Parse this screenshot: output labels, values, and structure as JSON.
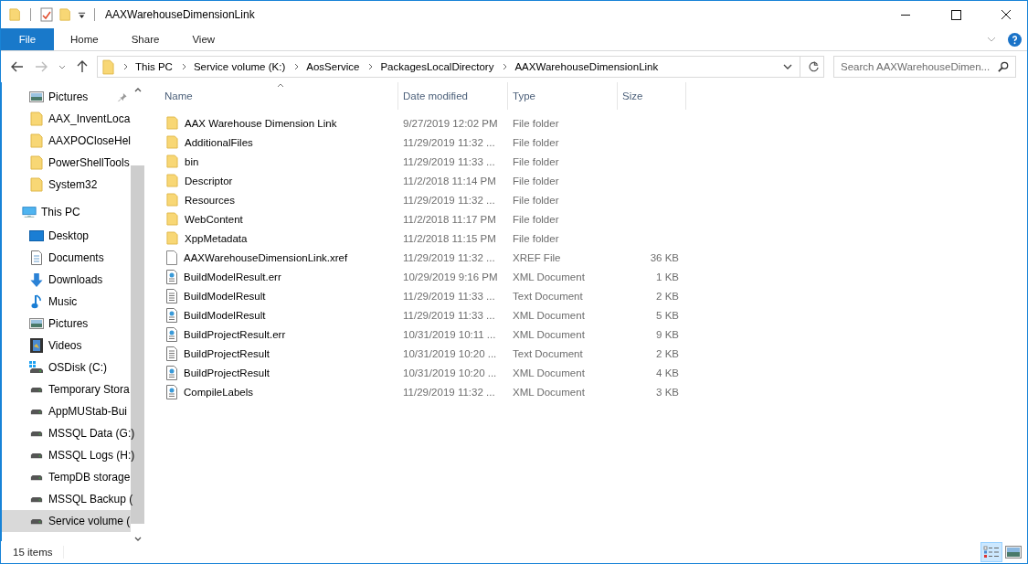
{
  "window": {
    "title": "AAXWarehouseDimensionLink"
  },
  "ribbon_tabs": [
    {
      "label": "File",
      "selected": true
    },
    {
      "label": "Home",
      "selected": false
    },
    {
      "label": "Share",
      "selected": false
    },
    {
      "label": "View",
      "selected": false
    }
  ],
  "address_bar": {
    "crumbs": [
      "This PC",
      "Service volume (K:)",
      "AosService",
      "PackagesLocalDirectory",
      "AAXWarehouseDimensionLink"
    ]
  },
  "search": {
    "placeholder": "Search AAXWarehouseDimen..."
  },
  "sidebar": {
    "quick_access_items": [
      {
        "label": "Pictures",
        "kind": "pictures",
        "pinned": true,
        "selected": false
      },
      {
        "label": "AAX_InventLoca",
        "kind": "folder",
        "pinned": false,
        "selected": false
      },
      {
        "label": "AAXPOCloseHel",
        "kind": "folder",
        "pinned": false,
        "selected": false
      },
      {
        "label": "PowerShellTools",
        "kind": "folder",
        "pinned": false,
        "selected": false
      },
      {
        "label": "System32",
        "kind": "folder",
        "pinned": false,
        "selected": false
      }
    ],
    "this_pc": {
      "label": "This PC",
      "children": [
        {
          "label": "Desktop",
          "kind": "desktop",
          "selected": false
        },
        {
          "label": "Documents",
          "kind": "documents",
          "selected": false
        },
        {
          "label": "Downloads",
          "kind": "downloads",
          "selected": false
        },
        {
          "label": "Music",
          "kind": "music",
          "selected": false
        },
        {
          "label": "Pictures",
          "kind": "pictures",
          "selected": false
        },
        {
          "label": "Videos",
          "kind": "videos",
          "selected": false
        },
        {
          "label": "OSDisk (C:)",
          "kind": "osdisk",
          "selected": false
        },
        {
          "label": "Temporary Stora",
          "kind": "drive",
          "selected": false
        },
        {
          "label": "AppMUStab-Bui",
          "kind": "drive",
          "selected": false
        },
        {
          "label": "MSSQL Data (G:)",
          "kind": "drive",
          "selected": false
        },
        {
          "label": "MSSQL Logs (H:)",
          "kind": "drive",
          "selected": false
        },
        {
          "label": "TempDB storage",
          "kind": "drive",
          "selected": false
        },
        {
          "label": "MSSQL Backup (",
          "kind": "drive",
          "selected": false
        },
        {
          "label": "Service volume (",
          "kind": "drive",
          "selected": true
        }
      ]
    }
  },
  "file_list": {
    "columns": [
      {
        "label": "Name",
        "sorted": true
      },
      {
        "label": "Date modified",
        "sorted": false
      },
      {
        "label": "Type",
        "sorted": false
      },
      {
        "label": "Size",
        "sorted": false
      }
    ],
    "rows": [
      {
        "name": "AAX Warehouse Dimension Link",
        "date": "9/27/2019 12:02 PM",
        "type": "File folder",
        "kind": "folder"
      },
      {
        "name": "AdditionalFiles",
        "date": "11/29/2019 11:32 ...",
        "type": "File folder",
        "kind": "folder"
      },
      {
        "name": "bin",
        "date": "11/29/2019 11:33 ...",
        "type": "File folder",
        "kind": "folder"
      },
      {
        "name": "Descriptor",
        "date": "11/2/2018 11:14 PM",
        "type": "File folder",
        "kind": "folder"
      },
      {
        "name": "Resources",
        "date": "11/29/2019 11:32 ...",
        "type": "File folder",
        "kind": "folder"
      },
      {
        "name": "WebContent",
        "date": "11/2/2018 11:17 PM",
        "type": "File folder",
        "kind": "folder"
      },
      {
        "name": "XppMetadata",
        "date": "11/2/2018 11:15 PM",
        "type": "File folder",
        "kind": "folder"
      },
      {
        "name": "AAXWarehouseDimensionLink.xref",
        "date": "11/29/2019 11:32 ...",
        "type": "XREF File",
        "size": "36 KB",
        "kind": "blank"
      },
      {
        "name": "BuildModelResult.err",
        "date": "10/29/2019 9:16 PM",
        "type": "XML Document",
        "size": "1 KB",
        "kind": "xml"
      },
      {
        "name": "BuildModelResult",
        "date": "11/29/2019 11:33 ...",
        "type": "Text Document",
        "size": "2 KB",
        "kind": "text"
      },
      {
        "name": "BuildModelResult",
        "date": "11/29/2019 11:33 ...",
        "type": "XML Document",
        "size": "5 KB",
        "kind": "xml"
      },
      {
        "name": "BuildProjectResult.err",
        "date": "10/31/2019 10:11 ...",
        "type": "XML Document",
        "size": "9 KB",
        "kind": "xml"
      },
      {
        "name": "BuildProjectResult",
        "date": "10/31/2019 10:20 ...",
        "type": "Text Document",
        "size": "2 KB",
        "kind": "text"
      },
      {
        "name": "BuildProjectResult",
        "date": "10/31/2019 10:20 ...",
        "type": "XML Document",
        "size": "4 KB",
        "kind": "xml"
      },
      {
        "name": "CompileLabels",
        "date": "11/29/2019 11:32 ...",
        "type": "XML Document",
        "size": "3 KB",
        "kind": "xml"
      }
    ]
  },
  "status_bar": {
    "item_count": "15 items",
    "view_buttons": [
      {
        "kind": "details",
        "selected": true
      },
      {
        "kind": "large_icons",
        "selected": false
      }
    ]
  }
}
